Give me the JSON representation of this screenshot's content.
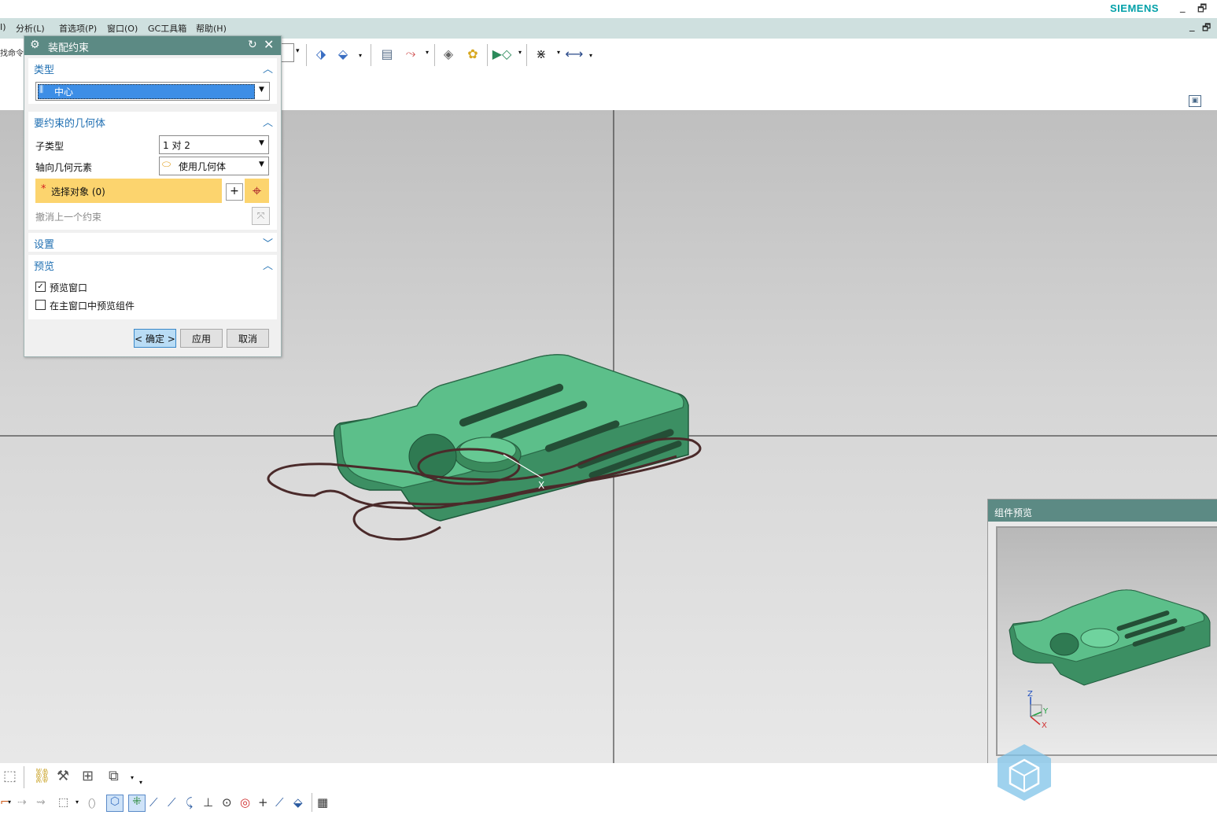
{
  "app": {
    "brand": "SIEMENS",
    "minimize": "_",
    "restore": "🗗"
  },
  "menu": {
    "items": [
      "I)",
      "分析(L)",
      "首选项(P)",
      "窗口(O)",
      "GC工具箱",
      "帮助(H)"
    ],
    "right_minimize": "_",
    "right_restore": "🗗"
  },
  "toolbar": {
    "find_command_partial": "找命令"
  },
  "dialog": {
    "title": "装配约束",
    "type_section": {
      "header": "类型",
      "selected": "中心"
    },
    "geometry_section": {
      "header": "要约束的几何体",
      "subtype_label": "子类型",
      "subtype_value": "1 对 2",
      "axial_label": "轴向几何元素",
      "axial_value": "使用几何体",
      "select_star": "*",
      "select_label": "选择对象 (0)",
      "undo_label": "撤消上一个约束"
    },
    "settings_section": {
      "header": "设置"
    },
    "preview_section": {
      "header": "预览",
      "preview_window_label": "预览窗口",
      "preview_window_checked": true,
      "preview_main_label": "在主窗口中预览组件",
      "preview_main_checked": false
    },
    "buttons": {
      "ok": "< 确定 >",
      "apply": "应用",
      "cancel": "取消"
    }
  },
  "viewport": {
    "axis_x_label": "X",
    "part_color": "#3f9a6b"
  },
  "component_preview": {
    "title": "组件预览",
    "triad_z": "Z",
    "triad_y": "Y",
    "triad_x": "X"
  },
  "colors": {
    "header_teal": "#5c8a84",
    "menubar": "#cfe0df",
    "accent_blue": "#1f6fb2",
    "select_highlight": "#fcd46e",
    "type_selected_bg": "#3d8ee6",
    "brand": "#00a0a8"
  }
}
